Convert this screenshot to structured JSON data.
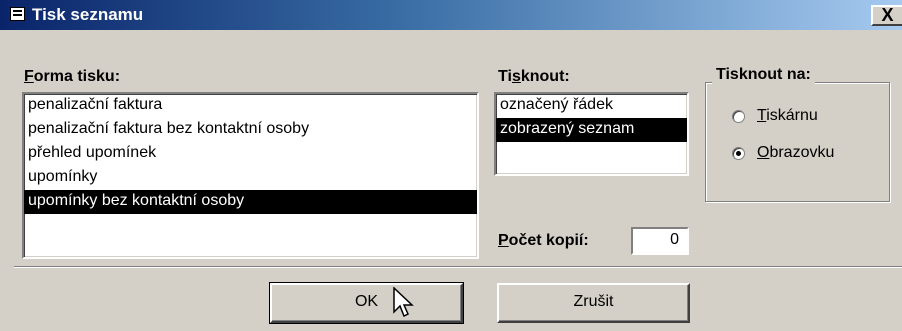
{
  "window": {
    "title": "Tisk seznamu",
    "close_label": "X"
  },
  "forma": {
    "label_accel": "F",
    "label_rest": "orma tisku:",
    "items": [
      {
        "label": "penalizační faktura",
        "selected": false
      },
      {
        "label": "penalizační faktura bez kontaktní osoby",
        "selected": false
      },
      {
        "label": "přehled upomínek",
        "selected": false
      },
      {
        "label": "upomínky",
        "selected": false
      },
      {
        "label": "upomínky bez kontaktní osoby",
        "selected": true
      }
    ]
  },
  "tisknout": {
    "label_pre": "Ti",
    "label_accel": "s",
    "label_post": "knout:",
    "items": [
      {
        "label": "označený řádek",
        "selected": false
      },
      {
        "label": "zobrazený seznam",
        "selected": true
      }
    ]
  },
  "tisknout_na": {
    "title": "Tisknout na:",
    "options": [
      {
        "accel": "T",
        "rest": "iskárnu",
        "checked": false
      },
      {
        "accel": "O",
        "rest": "brazovku",
        "checked": true
      }
    ]
  },
  "copies": {
    "label_accel": "P",
    "label_rest": "očet kopií:",
    "value": "0"
  },
  "buttons": {
    "ok": "OK",
    "cancel": "Zrušit"
  }
}
